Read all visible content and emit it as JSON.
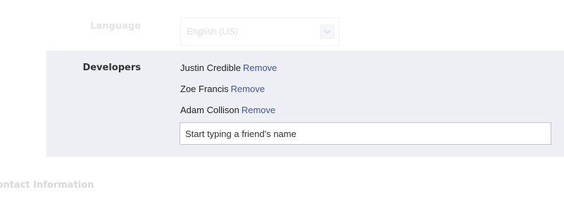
{
  "language": {
    "label": "Language",
    "selected_value": "English (US)"
  },
  "developers": {
    "label": "Developers",
    "items": [
      {
        "name": "Justin Credible",
        "action_label": "Remove"
      },
      {
        "name": "Zoe Francis",
        "action_label": "Remove"
      },
      {
        "name": "Adam Collison",
        "action_label": "Remove"
      }
    ],
    "input": {
      "placeholder": "Start typing a friend's name",
      "value": ""
    }
  },
  "contact_section": {
    "heading": "Contact Information"
  },
  "colors": {
    "panel_background": "#edeff4",
    "link": "#3b5998",
    "input_border": "#bdc7d8",
    "faded_text": "#e3e3e3"
  },
  "icons": {
    "language_dropdown": "chevron-down-icon"
  }
}
